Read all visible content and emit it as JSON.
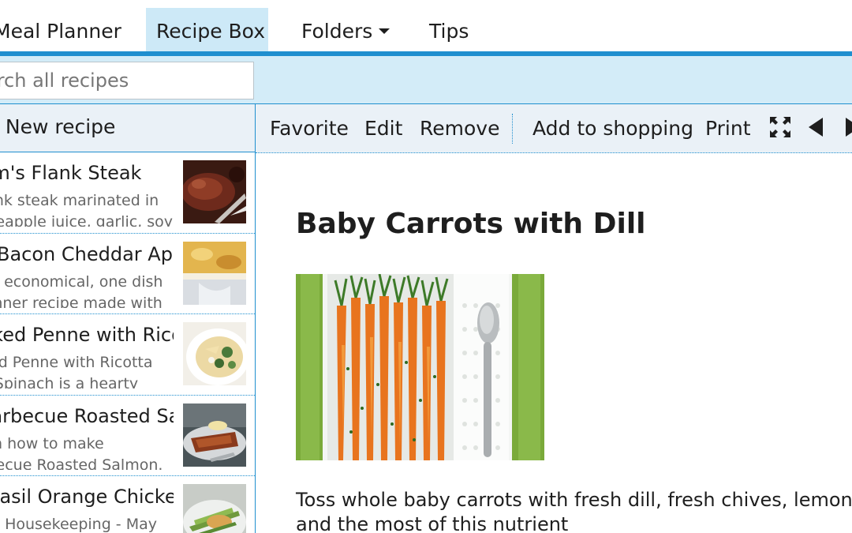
{
  "nav": {
    "items": [
      {
        "label": "Meal Planner"
      },
      {
        "label": "Recipe Box"
      },
      {
        "label": "Folders"
      },
      {
        "label": "Tips"
      }
    ]
  },
  "search": {
    "placeholder": "Search all recipes"
  },
  "sidebar": {
    "new_recipe_label": "+ New recipe",
    "recipes": [
      {
        "title": "Mom's Flank Steak",
        "desc": "Flank steak marinated in pineapple juice, garlic, soy sauce"
      },
      {
        "title": "Bacon Cheddar Apple",
        "desc": "An economical, one dish dinner recipe made with"
      },
      {
        "title": "Baked Penne with Ricotta",
        "desc": "Baked Penne with Ricotta and Spinach is a hearty"
      },
      {
        "title": "Barbecue Roasted Salmon",
        "desc": "Learn how to make Barbecue Roasted Salmon. MyRecipes"
      },
      {
        "title": "Basil Orange Chicken",
        "desc": "Good Housekeeping - May"
      }
    ]
  },
  "toolbar": {
    "favorite": "Favorite",
    "edit": "Edit",
    "remove": "Remove",
    "add_to_shopping": "Add to shopping",
    "print": "Print",
    "icons": [
      "expand-icon",
      "previous-icon",
      "next-icon"
    ]
  },
  "recipe": {
    "title": "Baby Carrots with Dill",
    "body": "Toss whole baby carrots with fresh dill, fresh chives, lemon, and the most of this nutrient"
  },
  "colors": {
    "accent": "#1f8fcf",
    "nav_active_bg": "#cde9f7",
    "search_strip_bg": "#d3ecf8",
    "toolbar_bg": "#eaf1f7"
  }
}
